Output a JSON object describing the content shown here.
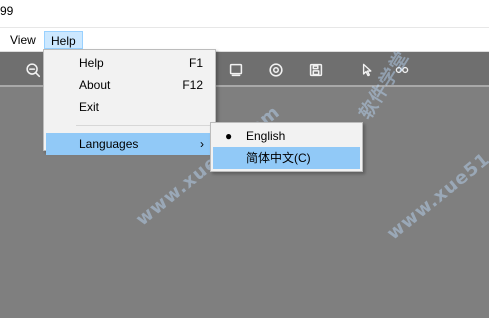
{
  "window": {
    "title": "99"
  },
  "menu_bar": {
    "view_label": "View",
    "help_label": "Help"
  },
  "help_menu": {
    "items": [
      {
        "label": "Help",
        "shortcut": "F1"
      },
      {
        "label": "About",
        "shortcut": "F12"
      },
      {
        "label": "Exit",
        "shortcut": ""
      }
    ],
    "languages_label": "Languages",
    "submenu_arrow": "›"
  },
  "languages_menu": {
    "items": [
      {
        "label": "English",
        "selected_marker": "●"
      },
      {
        "label": "简体中文(C)",
        "selected_marker": ""
      }
    ]
  },
  "toolbar": {
    "icons": [
      "zoom-icon",
      "crop-icon",
      "circle-record-icon",
      "save-icon",
      "cursor-icon",
      "glasses-icon"
    ]
  },
  "watermarks": {
    "top_left": "软件学堂",
    "bottom_left": "www.xue51.com",
    "top_right": "软件学堂",
    "bottom_right": "www.xue51.com"
  },
  "colors": {
    "menu_highlight": "#91c9f7",
    "toolbar_bg": "#6f6f6f",
    "canvas_bg": "#7f7f7f",
    "watermark": "#bedcff"
  }
}
